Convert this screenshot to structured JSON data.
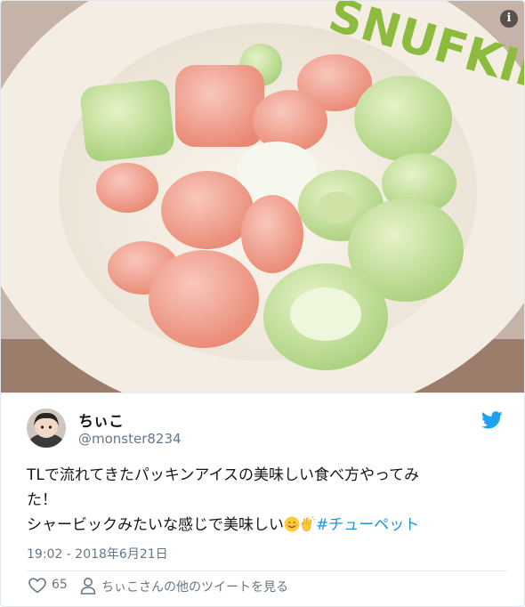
{
  "photo": {
    "bowl_brand_text": "SNUFKIN",
    "info_icon_glyph": "i"
  },
  "author": {
    "display_name": "ちぃこ",
    "handle": "@monster8234"
  },
  "tweet": {
    "line1": "TLで流れてきたパッキンアイスの美味しい食べ方やってみ",
    "line2": "た！",
    "line3_text": "シャービックみたいな感じで美味しい",
    "emoji_1": "smiling-face-icon",
    "emoji_2": "clapping-hands-icon",
    "hashtag": "#チューペット",
    "timestamp": "19:02 - 2018年6月21日"
  },
  "footer": {
    "like_count": "65",
    "more_tweets_label": "ちぃこさんの他のツイートを見る"
  },
  "colors": {
    "link": "#1b95e0",
    "twitter_blue": "#1da1f2",
    "muted_text": "#657786",
    "main_text": "#14171a"
  }
}
